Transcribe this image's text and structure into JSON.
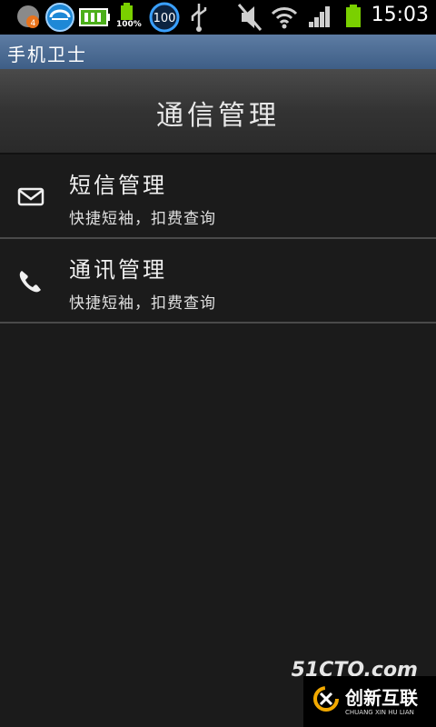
{
  "status_bar": {
    "badge_count": "4",
    "battery_percent": "100%",
    "circle_value": "100",
    "time": "15:03"
  },
  "app": {
    "title": "手机卫士"
  },
  "header": {
    "title": "通信管理"
  },
  "list": {
    "items": [
      {
        "title": "短信管理",
        "subtitle": "快捷短袖，扣费查询",
        "icon": "envelope-icon"
      },
      {
        "title": "通讯管理",
        "subtitle": "快捷短袖，扣费查询",
        "icon": "phone-icon"
      }
    ]
  },
  "watermark": {
    "site": "51CTO.com",
    "brand": "创新互联",
    "brand_en": "CHUANG XIN HU LIAN"
  },
  "colors": {
    "background": "#1b1b1b",
    "title_bar": "#4a6b94",
    "divider": "#4a4a4a",
    "watermark_accent": "#f2a900"
  }
}
